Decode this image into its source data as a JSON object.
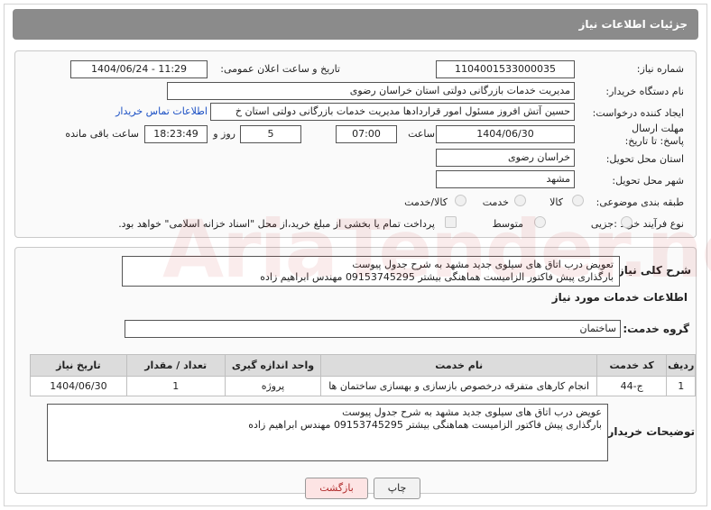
{
  "header": {
    "title": "جزئیات اطلاعات نیاز"
  },
  "form": {
    "need_number_label": "شماره نیاز:",
    "need_number_value": "1104001533000035",
    "announce_label": "تاریخ و ساعت اعلان عمومی:",
    "announce_value": "1404/06/24 - 11:29",
    "buyer_org_label": "نام دستگاه خریدار:",
    "buyer_org_value": "مدیریت خدمات بازرگانی دولتی استان خراسان رضوی",
    "creator_label": "ایجاد کننده درخواست:",
    "creator_value": "حسین آتش افروز مسئول امور قراردادها مدیریت خدمات بازرگانی دولتی استان خ",
    "contact_link": "اطلاعات تماس خریدار",
    "deadline_label": "مهلت ارسال پاسخ: تا تاریخ:",
    "deadline_date": "1404/06/30",
    "time_label": "ساعت",
    "deadline_time": "07:00",
    "days_value": "5",
    "days_label": "روز و",
    "remaining_time": "18:23:49",
    "remaining_label": "ساعت باقی مانده",
    "province_label": "استان محل تحویل:",
    "province_value": "خراسان رضوی",
    "city_label": "شهر محل تحویل:",
    "city_value": "مشهد",
    "category_label": "طبقه بندی موضوعی:",
    "category_options": [
      "کالا",
      "خدمت",
      "کالا/خدمت"
    ],
    "process_label": "نوع فرآیند خرید :",
    "process_options": [
      "جزیی",
      "متوسط"
    ],
    "payment_note": "پرداخت تمام یا بخشی از مبلغ خرید،از محل \"اسناد خزانه اسلامی\" خواهد بود."
  },
  "summary": {
    "label": "شرح کلی نیاز:",
    "text": "تعویض درب اتاق های سیلوی جدید مشهد به شرح جدول پیوست\nبارگذاری پیش فاکتور الزامیست هماهنگی بیشتر 09153745295 مهندس ابراهیم زاده"
  },
  "services": {
    "section_title": "اطلاعات خدمات مورد نیاز",
    "group_label": "گروه خدمت:",
    "group_value": "ساختمان",
    "columns": [
      "ردیف",
      "کد خدمت",
      "نام خدمت",
      "واحد اندازه گیری",
      "تعداد / مقدار",
      "تاریخ نیاز"
    ],
    "rows": [
      [
        "1",
        "ج-44",
        "انجام کارهای متفرقه درخصوص بازسازی و بهسازی ساختمان ها",
        "پروژه",
        "1",
        "1404/06/30"
      ]
    ]
  },
  "buyer_notes": {
    "label": "توضیحات خریدار:",
    "text": "عویض درب اتاق های سیلوی جدید مشهد به شرح جدول پیوست\nبارگذاری پیش فاکتور الزامیست هماهنگی بیشتر 09153745295 مهندس ابراهیم زاده"
  },
  "buttons": {
    "print": "چاپ",
    "back": "بازگشت"
  },
  "watermark": "AriaTender.neT"
}
